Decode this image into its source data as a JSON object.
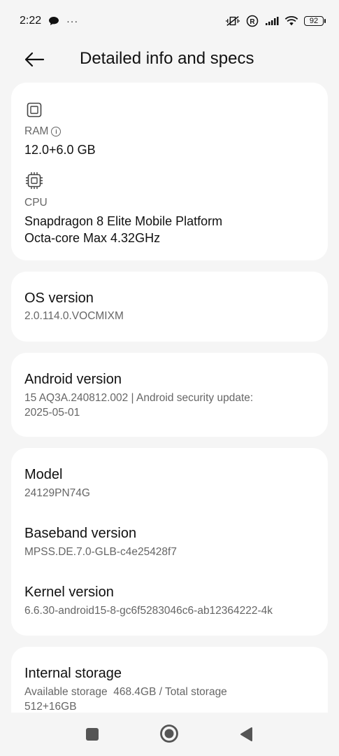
{
  "status_bar": {
    "time": "2:22",
    "more": "···",
    "battery": "92"
  },
  "header": {
    "title": "Detailed info and specs"
  },
  "card1": {
    "ram_label": "RAM",
    "ram_value": "12.0+6.0 GB",
    "cpu_label": "CPU",
    "cpu_line1": "Snapdragon 8 Elite Mobile Platform",
    "cpu_line2": "Octa-core Max 4.32GHz"
  },
  "os": {
    "title": "OS version",
    "value": "2.0.114.0.VOCMIXM"
  },
  "android": {
    "title": "Android version",
    "line1": "15 AQ3A.240812.002 | Android security update:",
    "line2": "2025-05-01"
  },
  "device": {
    "model_title": "Model",
    "model_value": "24129PN74G",
    "baseband_title": "Baseband version",
    "baseband_value": "MPSS.DE.7.0-GLB-c4e25428f7",
    "kernel_title": "Kernel version",
    "kernel_value": "6.6.30-android15-8-gc6f5283046c6-ab12364222-4k"
  },
  "storage": {
    "title": "Internal storage",
    "line1": "Available storage  468.4GB / Total storage",
    "line2": "512+16GB"
  }
}
